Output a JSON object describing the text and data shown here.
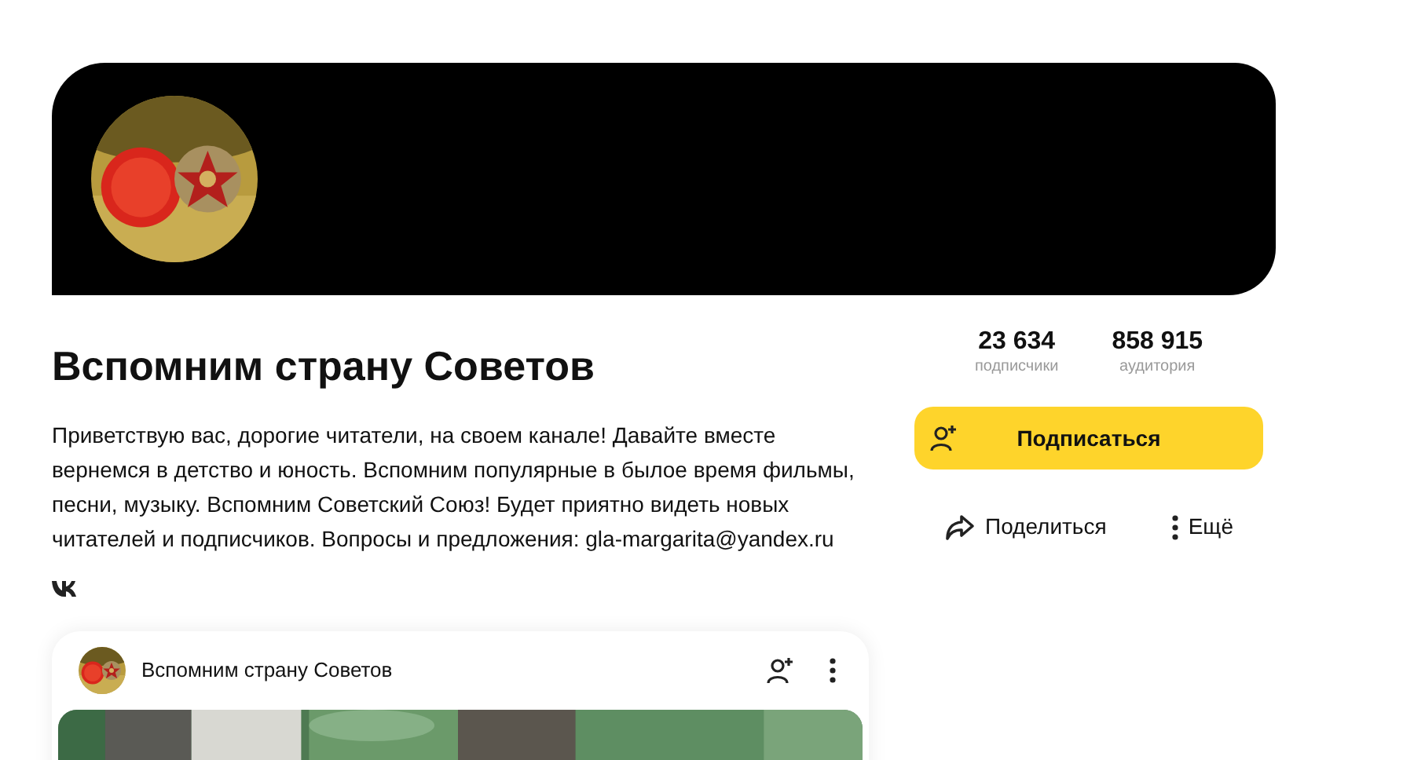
{
  "channel": {
    "title": "Вспомним страну Советов",
    "description": "Приветствую вас, дорогие читатели, на своем канале! Давайте вместе вернемся в детство и юность. Вспомним популярные в былое время фильмы, песни, музыку. Вспомним Советский Союз! Будет приятно видеть новых читателей и подписчиков. Вопросы и предложения: gla-margarita@yandex.ru"
  },
  "stats": [
    {
      "value": "23 634",
      "label": "подписчики"
    },
    {
      "value": "858 915",
      "label": "аудитория"
    }
  ],
  "subscribe_button": "Подписаться",
  "actions": [
    {
      "kind": "share",
      "label": "Поделиться"
    },
    {
      "kind": "more",
      "label": "Ещё"
    }
  ],
  "post": {
    "channel_name": "Вспомним страну Советов",
    "kind": "picture"
  }
}
